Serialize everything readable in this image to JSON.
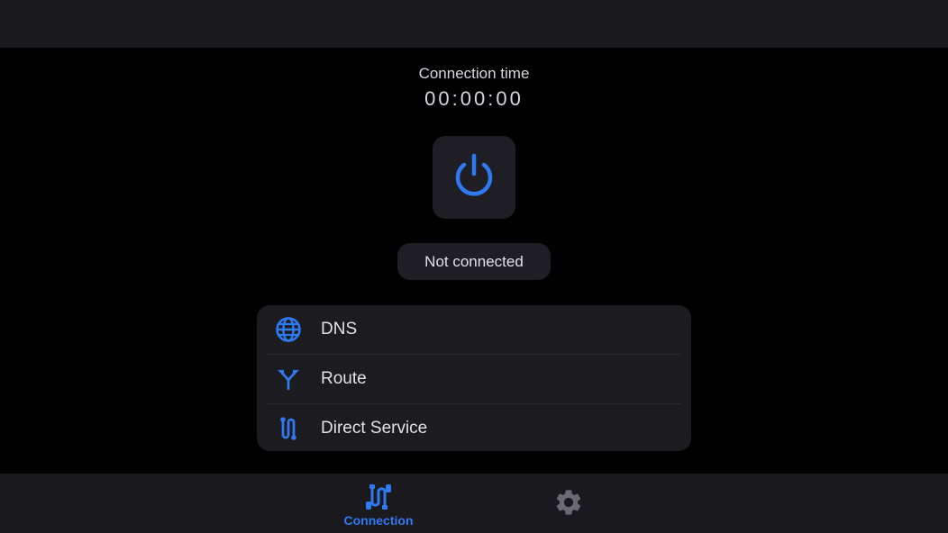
{
  "colors": {
    "accent": "#2f7af1",
    "background": "#000000",
    "surface": "#1a191e",
    "card": "#1c1b20",
    "inactive_icon": "#6b6a70"
  },
  "connection": {
    "time_label": "Connection time",
    "time_value": "00:00:00",
    "power_icon": "power-icon",
    "status": "Not connected"
  },
  "menu": {
    "items": [
      {
        "label": "DNS",
        "icon": "globe-icon"
      },
      {
        "label": "Route",
        "icon": "route-split-icon"
      },
      {
        "label": "Direct Service",
        "icon": "direct-service-icon"
      }
    ]
  },
  "bottom_nav": {
    "items": [
      {
        "label": "Connection",
        "icon": "connection-icon",
        "active": true
      },
      {
        "label": "",
        "icon": "gear-icon",
        "active": false
      }
    ]
  }
}
